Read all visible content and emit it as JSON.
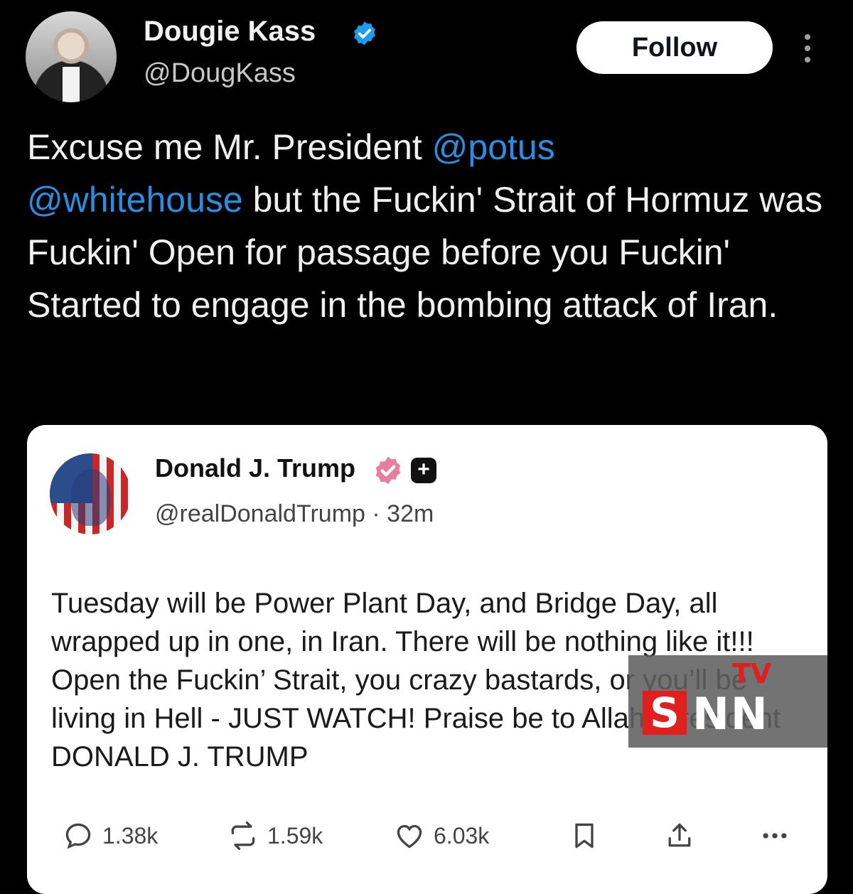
{
  "tweet": {
    "author_name": "Dougie Kass",
    "author_handle": "@DougKass",
    "follow_label": "Follow",
    "text_parts": {
      "p1": "Excuse me Mr. President ",
      "mention1": "@potus",
      "mention2": "@whitehouse",
      "p2": " but the Fuckin' Strait of Hormuz was Fuckin' Open for passage before you Fuckin' Started to engage in the bombing attack of Iran."
    },
    "icons": {
      "verified": "verified-badge-icon",
      "more": "more-vertical-icon"
    },
    "colors": {
      "mention": "#2a8de0",
      "verified": "#1d9bf0",
      "background": "#000000"
    }
  },
  "quote": {
    "author_name": "Donald J. Trump",
    "author_handle": "@realDonaldTrump",
    "separator": "·",
    "time": "32m",
    "plus_badge": "+",
    "text": "Tuesday will be Power Plant Day, and Bridge Day, all wrapped up in one, in Iran. There will be nothing like it!!! Open the Fuckin’ Strait, you crazy bastards, or you’ll be living in Hell - JUST WATCH! Praise be to Allah. President DONALD J. TRUMP",
    "colors": {
      "badge": "#e57fa0"
    },
    "actions": {
      "replies": "1.38k",
      "reposts": "1.59k",
      "likes": "6.03k"
    },
    "icons": [
      "reply-icon",
      "repost-icon",
      "like-icon",
      "bookmark-icon",
      "share-icon",
      "more-horizontal-icon"
    ]
  },
  "watermark": {
    "tv": "TV",
    "s": "S",
    "nn": "NN",
    "colors": {
      "red": "#e01f1f"
    }
  }
}
